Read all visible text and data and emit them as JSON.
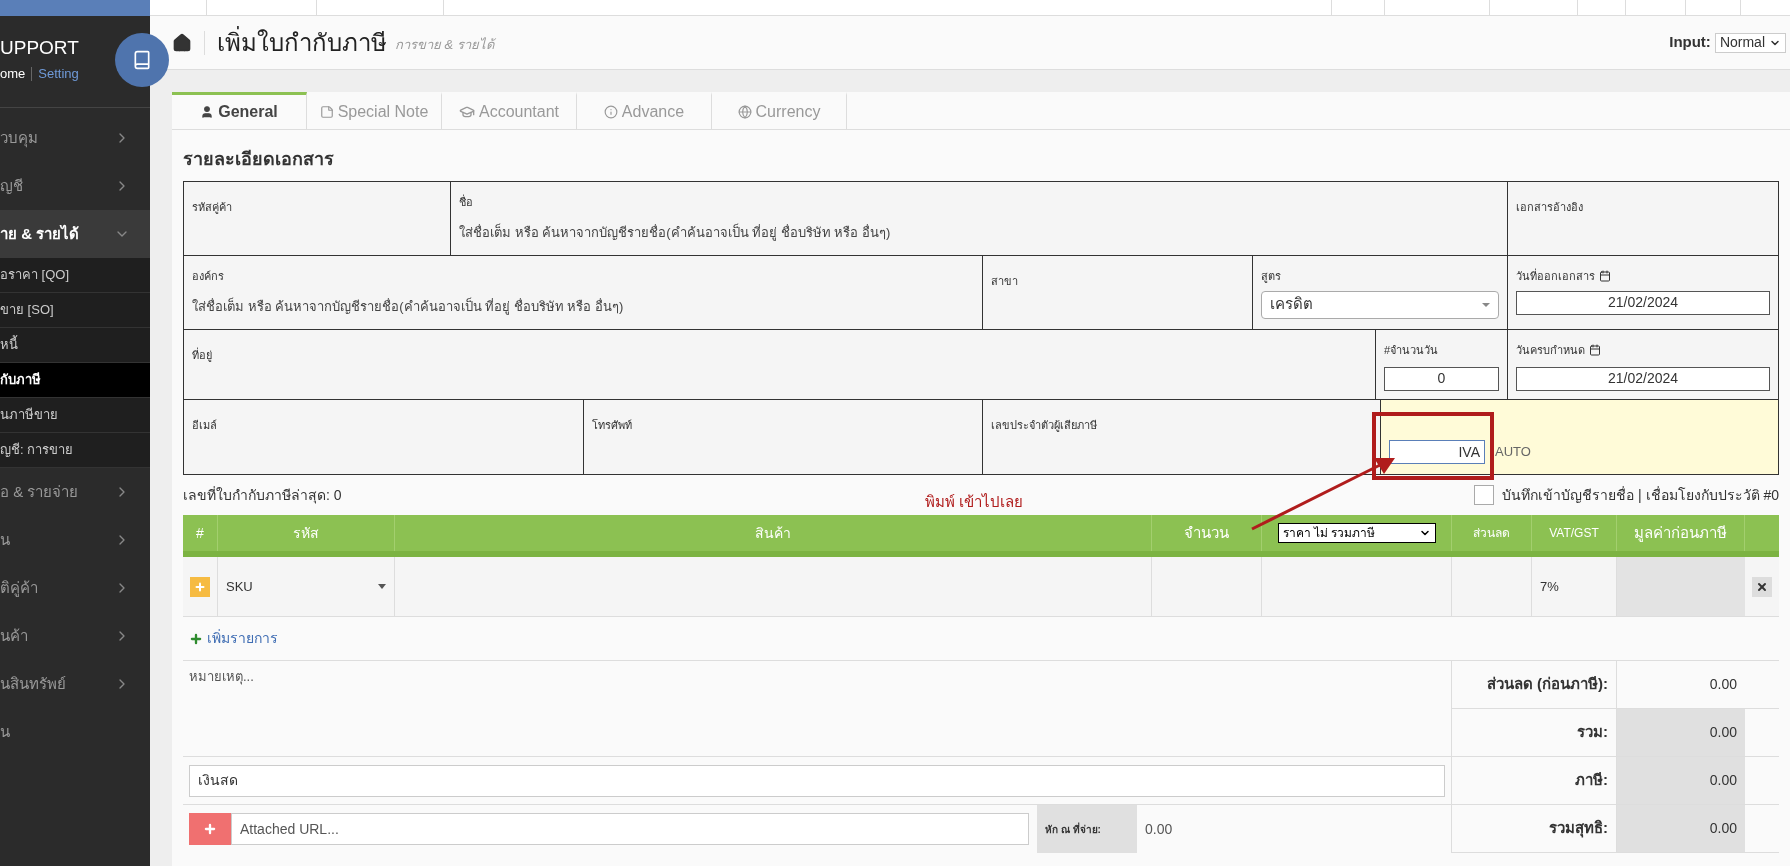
{
  "sidebar": {
    "brand": "UPPORT",
    "links": [
      "ome",
      "Setting"
    ],
    "menu": [
      {
        "label": "วบคุม",
        "kind": "group",
        "expanded": false
      },
      {
        "label": "ญชี",
        "kind": "group",
        "expanded": false
      },
      {
        "label": "าย & รายได้",
        "kind": "group",
        "expanded": true,
        "children": [
          {
            "label": "อราคา [QO]",
            "selected": false
          },
          {
            "label": "ขาย [SO]",
            "selected": false
          },
          {
            "label": "หนี้",
            "selected": false
          },
          {
            "label": "กับภาษี",
            "selected": true
          },
          {
            "label": "นภาษีขาย",
            "selected": false
          },
          {
            "label": "ญชี: การขาย",
            "selected": false
          }
        ]
      },
      {
        "label": "อ & รายจ่าย",
        "kind": "group",
        "expanded": false
      },
      {
        "label": "น",
        "kind": "group",
        "expanded": false
      },
      {
        "label": "ติคู่ค้า",
        "kind": "group",
        "expanded": false
      },
      {
        "label": "นค้า",
        "kind": "group",
        "expanded": false
      },
      {
        "label": "นสินทรัพย์",
        "kind": "group",
        "expanded": false
      },
      {
        "label": "น",
        "kind": "link",
        "expanded": false
      }
    ]
  },
  "header": {
    "title": "เพิ่มใบกำกับภาษี",
    "subtitle": "การขาย & รายได้",
    "input_label": "Input:",
    "input_value": "Normal"
  },
  "tabs": [
    {
      "label": "General",
      "selected": true
    },
    {
      "label": "Special Note",
      "selected": false
    },
    {
      "label": "Accountant",
      "selected": false
    },
    {
      "label": "Advance",
      "selected": false
    },
    {
      "label": "Currency",
      "selected": false
    }
  ],
  "section_title": "รายละเอียดเอกสาร",
  "form": {
    "customer_code": "รหัสคู่ค้า",
    "name_label": "ชื่อ",
    "name_placeholder": "ใส่ชื่อเต็ม หรือ ค้นหาจากบัญชีรายชื่อ(คำค้นอาจเป็น ที่อยู่ ชื่อบริษัท หรือ อื่นๆ)",
    "reference": "เอกสารอ้างอิง",
    "org_label": "องค์กร",
    "org_placeholder": "ใส่ชื่อเต็ม หรือ ค้นหาจากบัญชีรายชื่อ(คำค้นอาจเป็น ที่อยู่ ชื่อบริษัท หรือ อื่นๆ)",
    "branch": "สาขา",
    "formula_label": "สูตร",
    "formula_value": "เครดิต",
    "issue_date_label": "วันที่ออกเอกสาร",
    "issue_date": "21/02/2024",
    "address": "ที่อยู่",
    "days_label": "#จำนวนวัน",
    "days": "0",
    "due_label": "วันครบกำหนด",
    "due_date": "21/02/2024",
    "email": "อีเมล์",
    "phone": "โทรศัพท์",
    "tax_id": "เลขประจำตัวผู้เสียภาษี",
    "invoice_no": "IVA",
    "auto": "AUTO"
  },
  "last_invoice": "เลขที่ใบกำกับภาษีล่าสุด: 0",
  "annotation": "พิมพ์ เข้าไปเลย",
  "save_contact": {
    "label": "บันทึกเข้าบัญชีรายชื่อ | เชื่อมโยงกับประวัติ #0",
    "checked": false
  },
  "table": {
    "columns": [
      "#",
      "รหัส",
      "สินค้า",
      "จำนวน",
      "ราคา ไม่ รวมภาษี",
      "ส่วนลด",
      "VAT/GST",
      "มูลค่าก่อนภาษี"
    ],
    "rows": [
      {
        "sku": "SKU",
        "vat": "7%"
      }
    ],
    "add_item": "เพิ่มรายการ"
  },
  "notes_placeholder": "หมายเหตุ...",
  "payment": "เงินสด",
  "url_placeholder": "Attached URL...",
  "withholding_label": "หัก ณ ที่จ่าย:",
  "withholding": "0.00",
  "totals": [
    {
      "label": "ส่วนลด (ก่อนภาษี):",
      "value": "0.00"
    },
    {
      "label": "รวม:",
      "value": "0.00"
    },
    {
      "label": "ภาษี:",
      "value": "0.00"
    },
    {
      "label": "รวมสุทธิ:",
      "value": "0.00"
    }
  ]
}
